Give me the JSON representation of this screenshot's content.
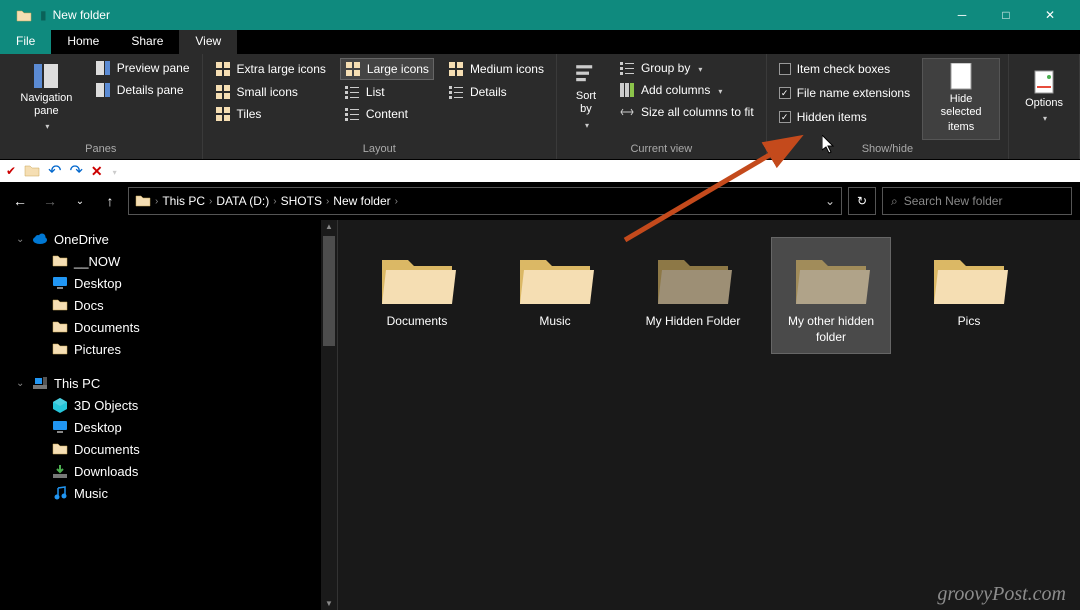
{
  "window": {
    "title": "New folder"
  },
  "tabs": {
    "file": "File",
    "home": "Home",
    "share": "Share",
    "view": "View"
  },
  "ribbon": {
    "panes": {
      "label": "Panes",
      "navigation": "Navigation pane",
      "preview": "Preview pane",
      "details": "Details pane"
    },
    "layout": {
      "label": "Layout",
      "xlarge": "Extra large icons",
      "large": "Large icons",
      "medium": "Medium icons",
      "small": "Small icons",
      "list": "List",
      "details": "Details",
      "tiles": "Tiles",
      "content": "Content"
    },
    "currentview": {
      "label": "Current view",
      "sort": "Sort by",
      "group": "Group by",
      "addcols": "Add columns",
      "sizeall": "Size all columns to fit"
    },
    "showhide": {
      "label": "Show/hide",
      "checkboxes": "Item check boxes",
      "extensions": "File name extensions",
      "hidden": "Hidden items",
      "hidesel1": "Hide selected",
      "hidesel2": "items"
    },
    "options": {
      "label": "Options"
    }
  },
  "breadcrumb": {
    "thispc": "This PC",
    "drive": "DATA (D:)",
    "shots": "SHOTS",
    "folder": "New folder"
  },
  "search": {
    "placeholder": "Search New folder"
  },
  "sidebar": {
    "onedrive": "OneDrive",
    "now": "__NOW",
    "desktop": "Desktop",
    "docs": "Docs",
    "documents": "Documents",
    "pictures": "Pictures",
    "thispc": "This PC",
    "objects3d": "3D Objects",
    "desktop2": "Desktop",
    "documents2": "Documents",
    "downloads": "Downloads",
    "music": "Music"
  },
  "folders": [
    {
      "name": "Documents",
      "hidden": false,
      "selected": false
    },
    {
      "name": "Music",
      "hidden": false,
      "selected": false
    },
    {
      "name": "My Hidden Folder",
      "hidden": true,
      "selected": false
    },
    {
      "name": "My other hidden folder",
      "hidden": true,
      "selected": true
    },
    {
      "name": "Pics",
      "hidden": false,
      "selected": false
    }
  ],
  "watermark": "groovyPost.com"
}
